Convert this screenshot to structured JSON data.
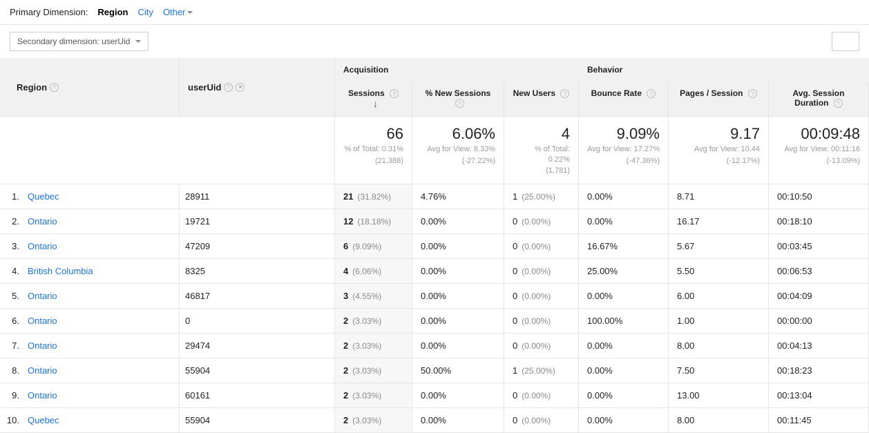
{
  "primary_dimension": {
    "label": "Primary Dimension:",
    "active": "Region",
    "links": [
      "City",
      "Other"
    ]
  },
  "secondary_dimension": {
    "label": "Secondary dimension: userUid"
  },
  "columns": {
    "region": "Region",
    "userUid": "userUid",
    "acquisition": "Acquisition",
    "behavior": "Behavior",
    "sessions": "Sessions",
    "pct_new_sessions": "% New Sessions",
    "new_users": "New Users",
    "bounce_rate": "Bounce Rate",
    "pages_per_session": "Pages / Session",
    "avg_session_duration": "Avg. Session Duration"
  },
  "summary": {
    "sessions": {
      "value": "66",
      "sub1": "% of Total: 0.31%",
      "sub2": "(21,388)"
    },
    "pct_new": {
      "value": "6.06%",
      "sub1": "Avg for View: 8.33%",
      "sub2": "(-27.22%)"
    },
    "new_users": {
      "value": "4",
      "sub1": "% of Total: 0.22%",
      "sub2": "(1,781)"
    },
    "bounce": {
      "value": "9.09%",
      "sub1": "Avg for View: 17.27%",
      "sub2": "(-47.36%)"
    },
    "pages": {
      "value": "9.17",
      "sub1": "Avg for View: 10.44",
      "sub2": "(-12.17%)"
    },
    "duration": {
      "value": "00:09:48",
      "sub1": "Avg for View: 00:11:16",
      "sub2": "(-13.09%)"
    }
  },
  "rows": [
    {
      "idx": "1.",
      "region": "Quebec",
      "userUid": "28911",
      "sessions": "21",
      "sess_pct": "(31.82%)",
      "pct_new": "4.76%",
      "new_users": "1",
      "new_users_pct": "(25.00%)",
      "bounce": "0.00%",
      "pages": "8.71",
      "duration": "00:10:50"
    },
    {
      "idx": "2.",
      "region": "Ontario",
      "userUid": "19721",
      "sessions": "12",
      "sess_pct": "(18.18%)",
      "pct_new": "0.00%",
      "new_users": "0",
      "new_users_pct": "(0.00%)",
      "bounce": "0.00%",
      "pages": "16.17",
      "duration": "00:18:10"
    },
    {
      "idx": "3.",
      "region": "Ontario",
      "userUid": "47209",
      "sessions": "6",
      "sess_pct": "(9.09%)",
      "pct_new": "0.00%",
      "new_users": "0",
      "new_users_pct": "(0.00%)",
      "bounce": "16.67%",
      "pages": "5.67",
      "duration": "00:03:45"
    },
    {
      "idx": "4.",
      "region": "British Columbia",
      "userUid": "8325",
      "sessions": "4",
      "sess_pct": "(6.06%)",
      "pct_new": "0.00%",
      "new_users": "0",
      "new_users_pct": "(0.00%)",
      "bounce": "25.00%",
      "pages": "5.50",
      "duration": "00:06:53"
    },
    {
      "idx": "5.",
      "region": "Ontario",
      "userUid": "46817",
      "sessions": "3",
      "sess_pct": "(4.55%)",
      "pct_new": "0.00%",
      "new_users": "0",
      "new_users_pct": "(0.00%)",
      "bounce": "0.00%",
      "pages": "6.00",
      "duration": "00:04:09"
    },
    {
      "idx": "6.",
      "region": "Ontario",
      "userUid": "0",
      "sessions": "2",
      "sess_pct": "(3.03%)",
      "pct_new": "0.00%",
      "new_users": "0",
      "new_users_pct": "(0.00%)",
      "bounce": "100.00%",
      "pages": "1.00",
      "duration": "00:00:00"
    },
    {
      "idx": "7.",
      "region": "Ontario",
      "userUid": "29474",
      "sessions": "2",
      "sess_pct": "(3.03%)",
      "pct_new": "0.00%",
      "new_users": "0",
      "new_users_pct": "(0.00%)",
      "bounce": "0.00%",
      "pages": "8.00",
      "duration": "00:04:13"
    },
    {
      "idx": "8.",
      "region": "Ontario",
      "userUid": "55904",
      "sessions": "2",
      "sess_pct": "(3.03%)",
      "pct_new": "50.00%",
      "new_users": "1",
      "new_users_pct": "(25.00%)",
      "bounce": "0.00%",
      "pages": "7.50",
      "duration": "00:18:23"
    },
    {
      "idx": "9.",
      "region": "Ontario",
      "userUid": "60161",
      "sessions": "2",
      "sess_pct": "(3.03%)",
      "pct_new": "0.00%",
      "new_users": "0",
      "new_users_pct": "(0.00%)",
      "bounce": "0.00%",
      "pages": "13.00",
      "duration": "00:13:04"
    },
    {
      "idx": "10.",
      "region": "Quebec",
      "userUid": "55904",
      "sessions": "2",
      "sess_pct": "(3.03%)",
      "pct_new": "0.00%",
      "new_users": "0",
      "new_users_pct": "(0.00%)",
      "bounce": "0.00%",
      "pages": "8.00",
      "duration": "00:11:45"
    }
  ]
}
